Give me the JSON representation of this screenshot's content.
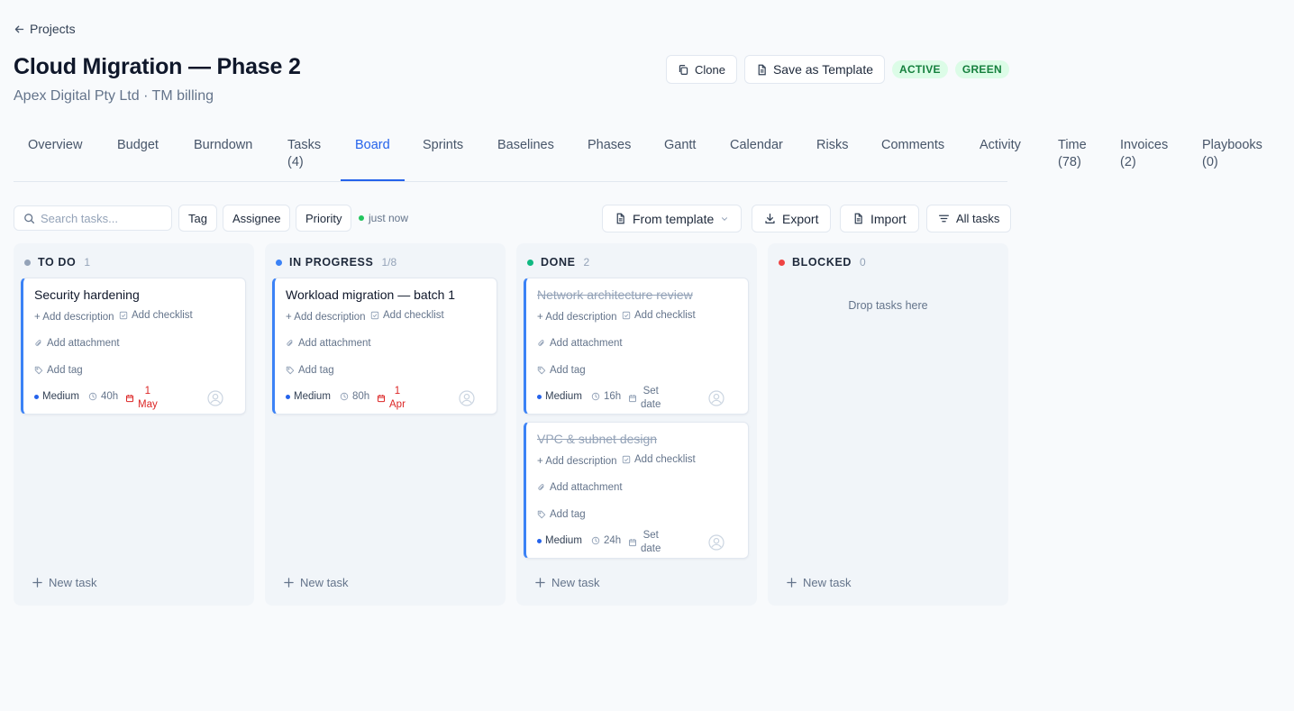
{
  "breadcrumb": {
    "label": "Projects"
  },
  "project": {
    "title": "Cloud Migration — Phase 2",
    "subtitle": "Apex Digital Pty Ltd · TM billing"
  },
  "actions": {
    "clone": "Clone",
    "save_template": "Save as Template",
    "status_badge": "ACTIVE",
    "health_badge": "GREEN"
  },
  "tabs": [
    {
      "line1": "Overview",
      "line2": ""
    },
    {
      "line1": "Budget",
      "line2": ""
    },
    {
      "line1": "Burndown",
      "line2": ""
    },
    {
      "line1": "Tasks",
      "line2": "(4)"
    },
    {
      "line1": "Board",
      "line2": "",
      "active": true
    },
    {
      "line1": "Sprints",
      "line2": ""
    },
    {
      "line1": "Baselines",
      "line2": ""
    },
    {
      "line1": "Phases",
      "line2": ""
    },
    {
      "line1": "Gantt",
      "line2": ""
    },
    {
      "line1": "Calendar",
      "line2": ""
    },
    {
      "line1": "Risks",
      "line2": ""
    },
    {
      "line1": "Comments",
      "line2": ""
    },
    {
      "line1": "Activity",
      "line2": ""
    },
    {
      "line1": "Time",
      "line2": "(78)"
    },
    {
      "line1": "Invoices",
      "line2": "(2)"
    },
    {
      "line1": "Playbooks",
      "line2": "(0)"
    }
  ],
  "toolbar": {
    "search_placeholder": "Search tasks...",
    "filters": [
      "Tag",
      "Assignee",
      "Priority"
    ],
    "sync_status": "just now",
    "from_template": "From template",
    "export": "Export",
    "import": "Import",
    "all_tasks": "All tasks"
  },
  "card_labels": {
    "add_description": "+ Add description",
    "add_checklist": "Add checklist",
    "add_attachment": "Add attachment",
    "add_tag": "Add tag"
  },
  "board": {
    "new_task": "New task",
    "drop_hint": "Drop tasks here",
    "columns": [
      {
        "title": "TO DO",
        "count": "1",
        "color": "#94a3b8",
        "cards": [
          {
            "title": "Security hardening",
            "done": false,
            "priority": "Medium",
            "estimate": "40h",
            "date_line1": "1",
            "date_line2": "May",
            "date_overdue": true
          }
        ]
      },
      {
        "title": "IN PROGRESS",
        "count": "1/8",
        "color": "#3b82f6",
        "cards": [
          {
            "title": "Workload migration — batch 1",
            "done": false,
            "priority": "Medium",
            "estimate": "80h",
            "date_line1": "1",
            "date_line2": "Apr",
            "date_overdue": true
          }
        ]
      },
      {
        "title": "DONE",
        "count": "2",
        "color": "#10b981",
        "cards": [
          {
            "title": "Network architecture review",
            "done": true,
            "priority": "Medium",
            "estimate": "16h",
            "date_line1": "Set",
            "date_line2": "date",
            "date_overdue": false
          },
          {
            "title": "VPC & subnet design",
            "done": true,
            "priority": "Medium",
            "estimate": "24h",
            "date_line1": "Set",
            "date_line2": "date",
            "date_overdue": false
          }
        ]
      },
      {
        "title": "BLOCKED",
        "count": "0",
        "color": "#ef4444",
        "cards": []
      }
    ]
  },
  "colors": {
    "accent": "#2563eb",
    "badge_bg": "#dcfce7",
    "badge_text": "#15803d",
    "overdue": "#dc2626"
  },
  "icons": [
    "arrow-left-icon",
    "copy-icon",
    "file-icon",
    "search-icon",
    "download-icon",
    "filter-icon",
    "plus-icon",
    "checkbox-icon",
    "paperclip-icon",
    "tag-icon",
    "clock-icon",
    "calendar-icon",
    "repeat-icon",
    "shield-icon",
    "user-avatar-icon",
    "eye-icon",
    "chevron-down-icon"
  ]
}
